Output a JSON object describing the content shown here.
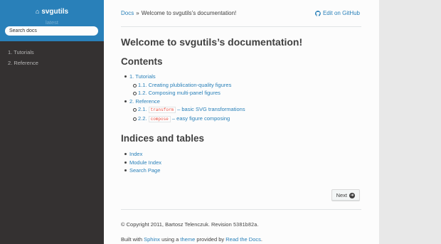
{
  "sidebar": {
    "project": "svgutils",
    "version": "latest",
    "search_placeholder": "Search docs",
    "nav": [
      "1. Tutorials",
      "2. Reference"
    ]
  },
  "breadcrumb": {
    "home": "Docs",
    "sep": "»",
    "current": "Welcome to svgutils’s documentation!",
    "github": "Edit on GitHub"
  },
  "main": {
    "title": "Welcome to svgutils’s documentation!",
    "contents_heading": "Contents",
    "toc": {
      "tutorials": "1. Tutorials",
      "t1": "1.1. Creating plublication-quality figures",
      "t2": "1.2. Composing multi-panel figures",
      "reference": "2. Reference",
      "r1_num": "2.1.",
      "r1_code": "transform",
      "r1_text": "– basic SVG transformations",
      "r2_num": "2.2.",
      "r2_code": "compose",
      "r2_text": "– easy figure composing"
    },
    "indices_heading": "Indices and tables",
    "indices": [
      "Index",
      "Module Index",
      "Search Page"
    ]
  },
  "pager": {
    "next": "Next"
  },
  "footer": {
    "copyright": "© Copyright 2011, Bartosz Telenczuk. Revision",
    "revision": "5381b82a",
    "dot": ".",
    "built_with": "Built with",
    "sphinx": "Sphinx",
    "using_a": "using a",
    "theme": "theme",
    "provided_by": "provided by",
    "rtd": "Read the Docs"
  },
  "colors": {
    "accent": "#2980b9",
    "sidebar": "#343131",
    "text": "#404040"
  }
}
